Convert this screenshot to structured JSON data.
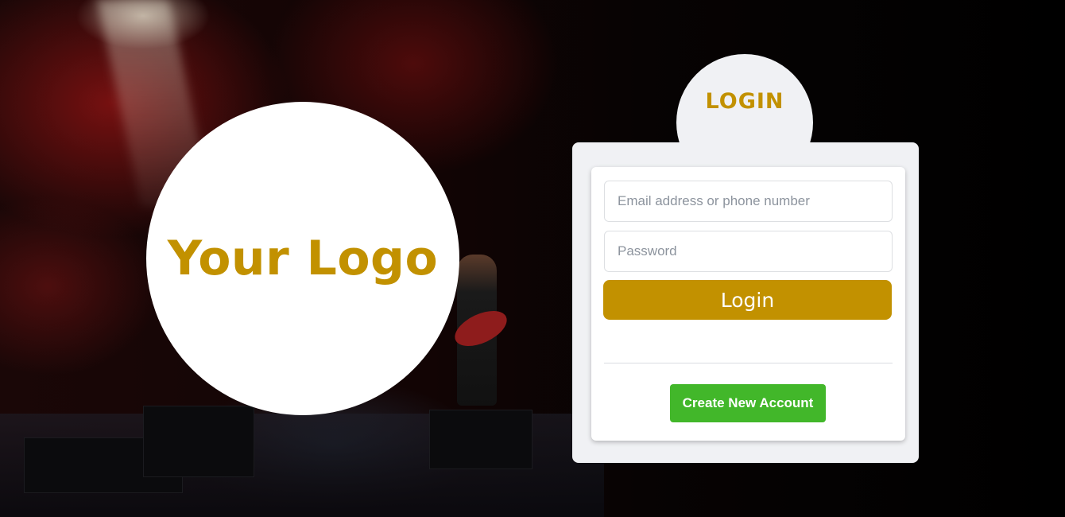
{
  "logo": {
    "text": "Your Logo"
  },
  "login_form": {
    "heading": "LOGIN",
    "email_placeholder": "Email address or phone number",
    "password_placeholder": "Password",
    "login_button": "Login",
    "create_account_button": "Create New Account"
  },
  "colors": {
    "accent_gold": "#c29100",
    "create_green": "#42b72a",
    "panel_bg": "#f0f1f4"
  }
}
